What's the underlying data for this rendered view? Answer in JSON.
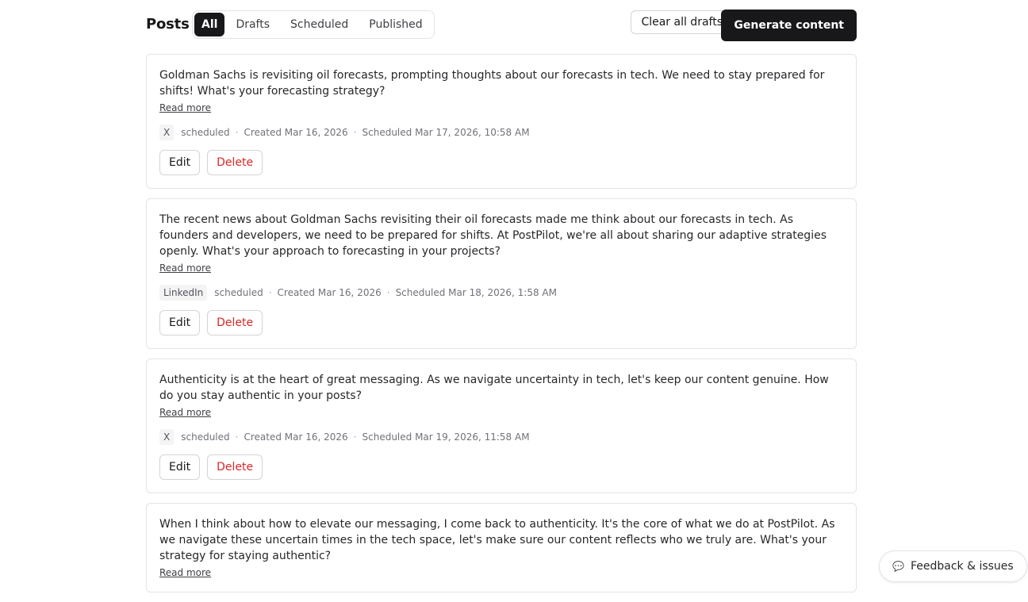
{
  "header": {
    "title": "Posts",
    "tabs": [
      {
        "label": "All",
        "active": true
      },
      {
        "label": "Drafts",
        "active": false
      },
      {
        "label": "Scheduled",
        "active": false
      },
      {
        "label": "Published",
        "active": false
      }
    ],
    "clear_drafts_label": "Clear all drafts",
    "generate_label": "Generate content"
  },
  "posts": [
    {
      "text": "Goldman Sachs is revisiting oil forecasts, prompting thoughts about our forecasts in tech. We need to stay prepared for shifts! What's your forecasting strategy?",
      "read_more": "Read more",
      "platform": "X",
      "status": "scheduled",
      "created": "Created Mar 16, 2026",
      "scheduled": "Scheduled Mar 17, 2026, 10:58 AM",
      "edit_label": "Edit",
      "delete_label": "Delete"
    },
    {
      "text": "The recent news about Goldman Sachs revisiting their oil forecasts made me think about our forecasts in tech. As founders and developers, we need to be prepared for shifts. At PostPilot, we're all about sharing our adaptive strategies openly. What's your approach to forecasting in your projects?",
      "read_more": "Read more",
      "platform": "LinkedIn",
      "status": "scheduled",
      "created": "Created Mar 16, 2026",
      "scheduled": "Scheduled Mar 18, 2026, 1:58 AM",
      "edit_label": "Edit",
      "delete_label": "Delete"
    },
    {
      "text": "Authenticity is at the heart of great messaging. As we navigate uncertainty in tech, let's keep our content genuine. How do you stay authentic in your posts?",
      "read_more": "Read more",
      "platform": "X",
      "status": "scheduled",
      "created": "Created Mar 16, 2026",
      "scheduled": "Scheduled Mar 19, 2026, 11:58 AM",
      "edit_label": "Edit",
      "delete_label": "Delete"
    },
    {
      "text": "When I think about how to elevate our messaging, I come back to authenticity. It's the core of what we do at PostPilot. As we navigate these uncertain times in the tech space, let's make sure our content reflects who we truly are. What's your strategy for staying authentic?",
      "read_more": "Read more"
    }
  ],
  "feedback": {
    "icon": "chat-bubble-icon",
    "label": "Feedback & issues"
  }
}
